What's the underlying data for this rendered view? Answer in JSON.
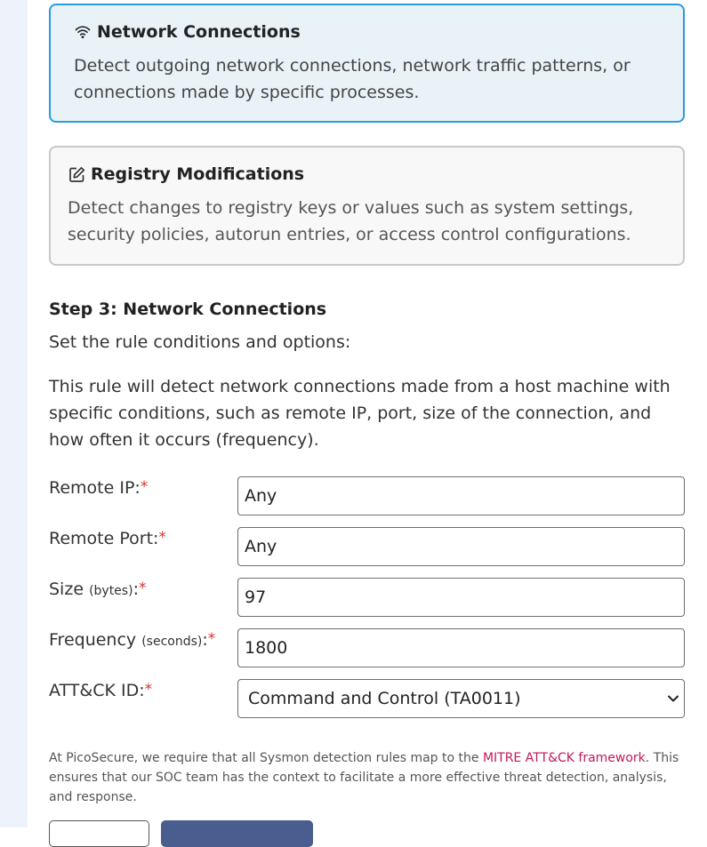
{
  "cards": [
    {
      "title": "Network Connections",
      "icon": "wifi-icon",
      "description": "Detect outgoing network connections, network traffic patterns, or connections made by specific processes.",
      "selected": true
    },
    {
      "title": "Registry Modifications",
      "icon": "edit-icon",
      "description": "Detect changes to registry keys or values such as system settings, security policies, autorun entries, or access control configurations.",
      "selected": false
    }
  ],
  "step": {
    "title": "Step 3: Network Connections",
    "subtitle": "Set the rule conditions and options:",
    "intro": "This rule will detect network connections made from a host machine with specific conditions, such as remote IP, port, size of the connection, and how often it occurs (frequency)."
  },
  "form": {
    "remote_ip": {
      "label": "Remote IP:",
      "value": "Any",
      "required": "*"
    },
    "remote_port": {
      "label": "Remote Port:",
      "value": "Any",
      "required": "*"
    },
    "size": {
      "label": "Size",
      "unit": "(bytes)",
      "colon": ":",
      "value": "97",
      "required": "*"
    },
    "frequency": {
      "label": "Frequency",
      "unit": "(seconds)",
      "colon": ":",
      "value": "1800",
      "required": "*"
    },
    "attack_id": {
      "label": "ATT&CK ID:",
      "value": "Command and Control (TA0011)",
      "required": "*"
    }
  },
  "note": {
    "before_link": "At PicoSecure, we require that all Sysmon detection rules map to the ",
    "link": "MITRE ATT&CK framework",
    "after_link": ". This ensures that our SOC team has the context to facilitate a more effective threat detection, analysis, and response."
  },
  "colors": {
    "selected_border": "#2b9ae4",
    "selected_bg": "#e9f3f7",
    "required": "#d9342b",
    "link": "#c2185b",
    "primary_button": "#4a5d8f"
  }
}
